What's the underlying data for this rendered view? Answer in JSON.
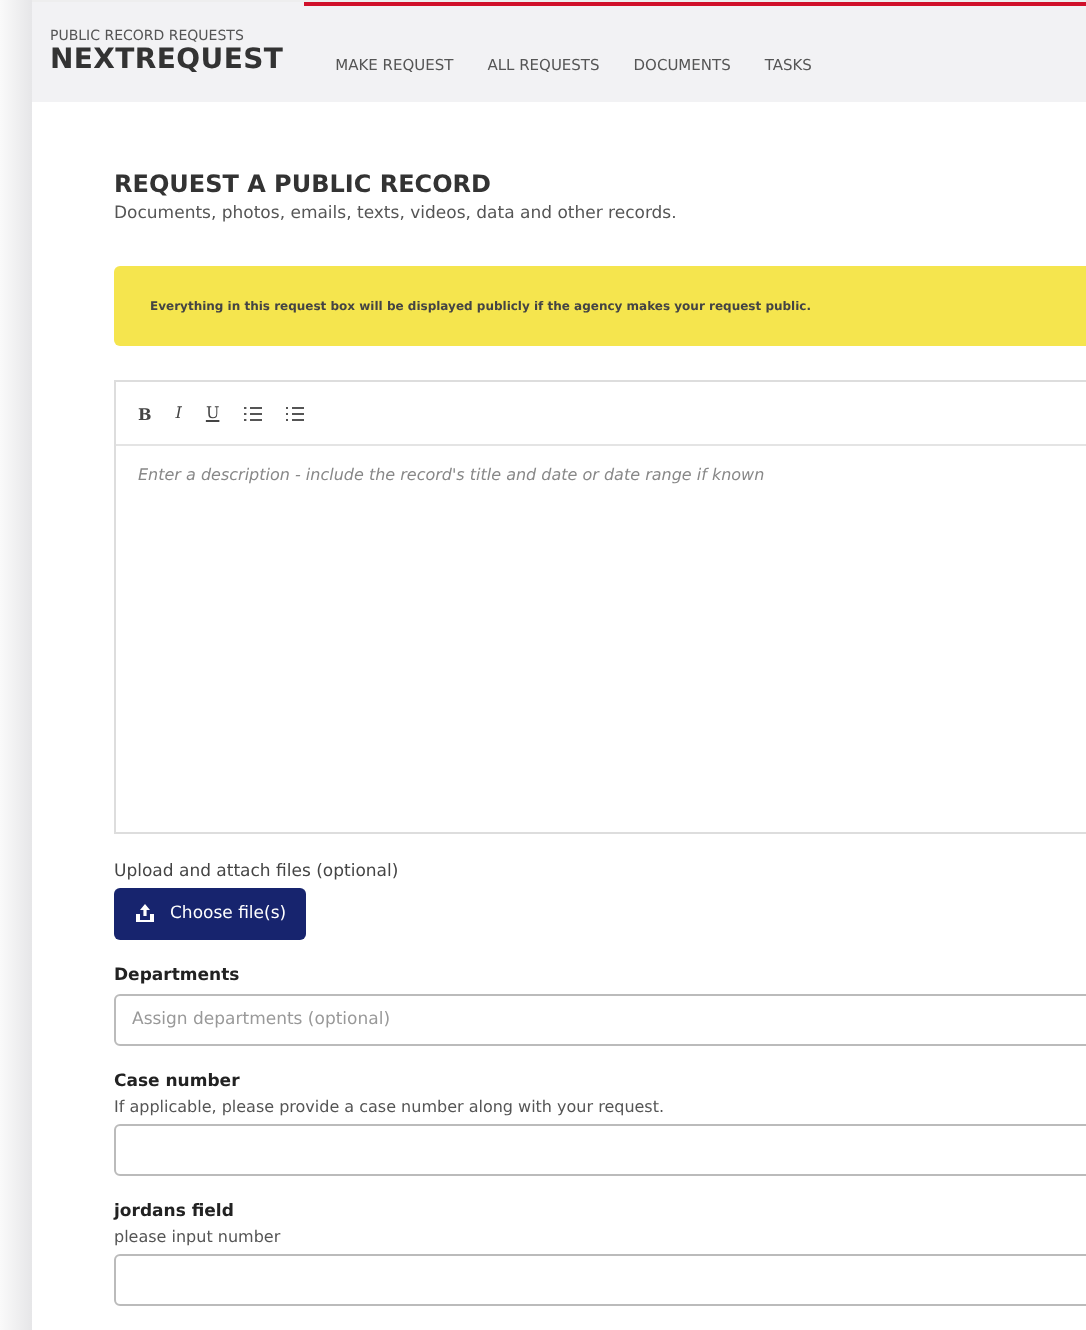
{
  "header": {
    "subtitle": "PUBLIC RECORD REQUESTS",
    "brand": "NEXTREQUEST",
    "nav": [
      {
        "label": "MAKE REQUEST"
      },
      {
        "label": "ALL REQUESTS"
      },
      {
        "label": "DOCUMENTS"
      },
      {
        "label": "TASKS"
      }
    ]
  },
  "title": "REQUEST A PUBLIC RECORD",
  "subtitle": "Documents, photos, emails, texts, videos, data and other records.",
  "notice": "Everything in this request box will be displayed publicly if the agency makes your request public.",
  "editor": {
    "toolbar": [
      {
        "kind": "bold",
        "label": "B"
      },
      {
        "kind": "italic",
        "label": "I"
      },
      {
        "kind": "underline",
        "label": "U"
      },
      {
        "kind": "bullets"
      },
      {
        "kind": "numbers"
      }
    ],
    "placeholder": "Enter a description - include the record's title and date or date range if known"
  },
  "upload": {
    "label": "Upload and attach files (optional)",
    "button": "Choose file(s)"
  },
  "fields": [
    {
      "label": "Departments",
      "placeholder": "Assign departments (optional)"
    },
    {
      "label": "Case number",
      "help": "If applicable, please provide a case number along with your request."
    },
    {
      "label": "jordans field",
      "help": "please input number"
    }
  ]
}
